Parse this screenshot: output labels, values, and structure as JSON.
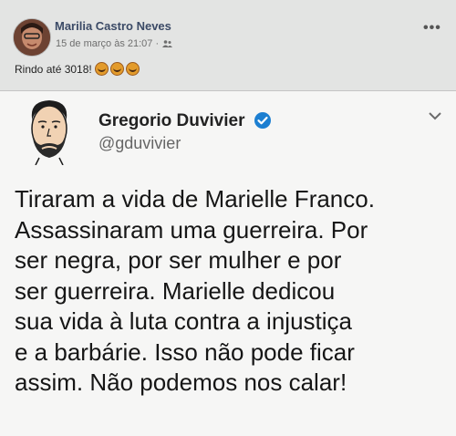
{
  "post": {
    "author_name": "Marilia Castro Neves",
    "timestamp": "15 de março às 21:07 ·",
    "audience_icon": "friends-icon",
    "menu_label": "•••",
    "caption": "Rindo até 3018!",
    "caption_emojis": [
      "grinning-face-icon",
      "grinning-face-icon",
      "grinning-face-icon"
    ]
  },
  "tweet": {
    "author_name": "Gregorio Duvivier",
    "handle": "@gduvivier",
    "verified_icon": "verified-badge-icon",
    "menu_icon": "chevron-down-icon",
    "lines": [
      "Tiraram a vida de Marielle Franco.",
      "Assassinaram uma guerreira. Por",
      "ser negra, por ser mulher e por",
      "ser guerreira. Marielle dedicou",
      "sua vida à luta contra a injustiça",
      "e a barbárie. Isso não pode ficar",
      "assim. Não podemos nos calar!"
    ]
  },
  "colors": {
    "background": "#cfd0cf",
    "header_background": "#e3e4e3",
    "card_background": "#f6f6f5",
    "name_link": "#3b4a66",
    "verified_blue": "#1c7fd1"
  }
}
